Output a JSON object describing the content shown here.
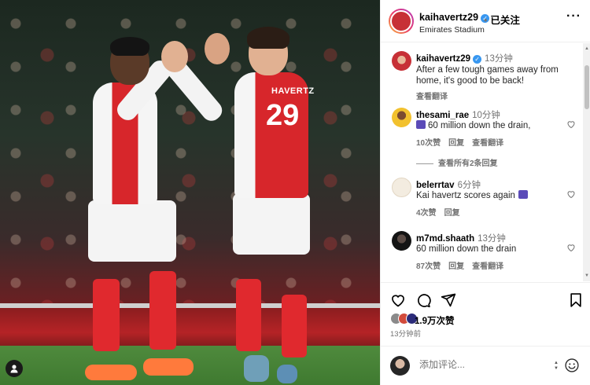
{
  "post": {
    "author": "kaihavertz29",
    "follow_status": "已关注",
    "location": "Emirates Stadium",
    "more_icon": "more-icon",
    "shirt_name": "HAVERTZ",
    "shirt_number": "29"
  },
  "comments": [
    {
      "user": "kaihavertz29",
      "time": "13分钟",
      "text": "After a few tough games away from home, it's good to be back!",
      "translate": "查看翻译"
    },
    {
      "user": "thesami_rae",
      "time": "10分钟",
      "text": "60 million down the drain,",
      "likes": "10次赞",
      "reply": "回复",
      "translate": "查看翻译",
      "view_replies": "查看所有2条回复"
    },
    {
      "user": "belerrtav",
      "time": "6分钟",
      "text": "Kai havertz scores again",
      "likes": "4次赞",
      "reply": "回复"
    },
    {
      "user": "m7md.shaath",
      "time": "13分钟",
      "text": "60 million down the drain",
      "likes": "87次赞",
      "reply": "回复",
      "translate": "查看翻译"
    }
  ],
  "actions": {
    "likes_count": "1.9万次赞",
    "posted_ago": "13分钟前"
  },
  "add_comment": {
    "placeholder": "添加评论..."
  },
  "colors": {
    "verified_blue": "#3897f0",
    "arsenal_red": "#d7262b",
    "muted_text": "#737373"
  }
}
